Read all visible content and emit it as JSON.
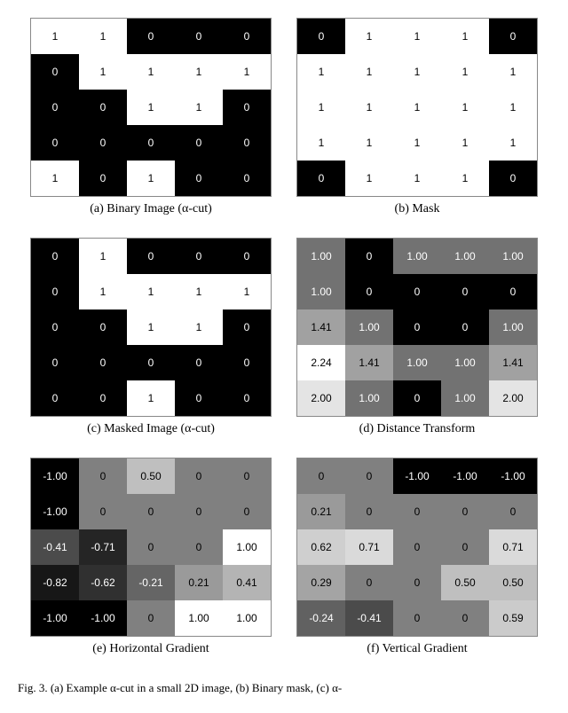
{
  "panels": [
    {
      "id": "a",
      "caption": "(a) Binary Image (α-cut)",
      "cells": [
        [
          1,
          1,
          0,
          0,
          0
        ],
        [
          0,
          1,
          1,
          1,
          1
        ],
        [
          0,
          0,
          1,
          1,
          0
        ],
        [
          0,
          0,
          0,
          0,
          0
        ],
        [
          1,
          0,
          1,
          0,
          0
        ]
      ],
      "mode": "binary"
    },
    {
      "id": "b",
      "caption": "(b) Mask",
      "cells": [
        [
          0,
          1,
          1,
          1,
          0
        ],
        [
          1,
          1,
          1,
          1,
          1
        ],
        [
          1,
          1,
          1,
          1,
          1
        ],
        [
          1,
          1,
          1,
          1,
          1
        ],
        [
          0,
          1,
          1,
          1,
          0
        ]
      ],
      "mode": "binary"
    },
    {
      "id": "c",
      "caption": "(c) Masked Image (α-cut)",
      "cells": [
        [
          0,
          1,
          0,
          0,
          0
        ],
        [
          0,
          1,
          1,
          1,
          1
        ],
        [
          0,
          0,
          1,
          1,
          0
        ],
        [
          0,
          0,
          0,
          0,
          0
        ],
        [
          0,
          0,
          1,
          0,
          0
        ]
      ],
      "mode": "binary"
    },
    {
      "id": "d",
      "caption": "(d) Distance Transform",
      "cells": [
        [
          1.0,
          0,
          1.0,
          1.0,
          1.0
        ],
        [
          1.0,
          0,
          0,
          0,
          0
        ],
        [
          1.41,
          1.0,
          0,
          0,
          1.0
        ],
        [
          2.24,
          1.41,
          1.0,
          1.0,
          1.41
        ],
        [
          2.0,
          1.0,
          0,
          1.0,
          2.0
        ]
      ],
      "mode": "gray",
      "min": 0,
      "max": 2.24
    },
    {
      "id": "e",
      "caption": "(e) Horizontal Gradient",
      "cells": [
        [
          -1.0,
          0,
          0.5,
          0,
          0
        ],
        [
          -1.0,
          0,
          0,
          0,
          0
        ],
        [
          -0.41,
          -0.71,
          0,
          0,
          1.0
        ],
        [
          -0.82,
          -0.62,
          -0.21,
          0.21,
          0.41
        ],
        [
          -1.0,
          -1.0,
          0,
          1.0,
          1.0
        ]
      ],
      "mode": "gray",
      "min": -1.0,
      "max": 1.0
    },
    {
      "id": "f",
      "caption": "(f) Vertical Gradient",
      "cells": [
        [
          0,
          0,
          -1.0,
          -1.0,
          -1.0
        ],
        [
          0.21,
          0,
          0,
          0,
          0
        ],
        [
          0.62,
          0.71,
          0,
          0,
          0.71
        ],
        [
          0.29,
          0,
          0,
          0.5,
          0.5
        ],
        [
          -0.24,
          -0.41,
          0,
          0,
          0.59
        ]
      ],
      "mode": "gray",
      "min": -1.0,
      "max": 1.0
    }
  ],
  "figure_caption": "Fig. 3.   (a) Example α-cut in a small 2D image, (b) Binary mask, (c) α-"
}
